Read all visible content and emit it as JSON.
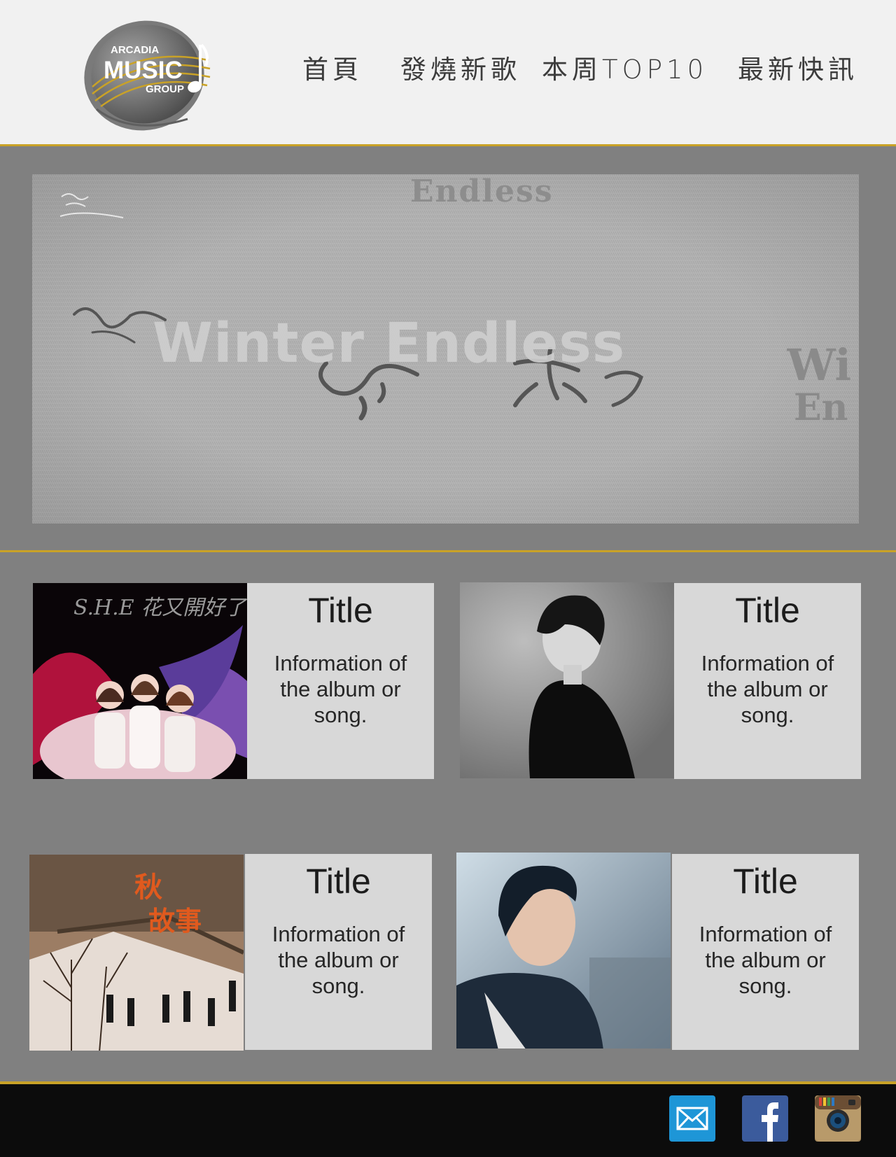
{
  "brand": {
    "logo_line1": "ARCADIA",
    "logo_line2": "MUSIC",
    "logo_line3": "GROUP"
  },
  "nav": [
    {
      "label": "首頁"
    },
    {
      "label": "發燒新歌"
    },
    {
      "label": "本周TOP10"
    },
    {
      "label": "最新快訊"
    }
  ],
  "hero": {
    "top_text": "Endless",
    "main_text": "Winter Endless",
    "side_text_1": "Wi",
    "side_text_2": "En"
  },
  "cards": [
    {
      "title": "Title",
      "info": "Information of the album or song.",
      "cover_caption": "S.H.E 花又開好了"
    },
    {
      "title": "Title",
      "info": "Information of the album or song."
    },
    {
      "title": "Title",
      "info": "Information of the album or song."
    },
    {
      "title": "Title",
      "info": "Information of the album or song."
    }
  ],
  "footer": {
    "icons": [
      "mail-icon",
      "facebook-icon",
      "instagram-icon"
    ]
  },
  "colors": {
    "accent": "#c9a227",
    "page_bg": "#808080",
    "header_bg": "#f1f1f1",
    "card_bg": "#d8d8d8",
    "footer_bg": "#0c0c0c",
    "mail": "#1e96d7",
    "facebook": "#3b5b9c"
  }
}
